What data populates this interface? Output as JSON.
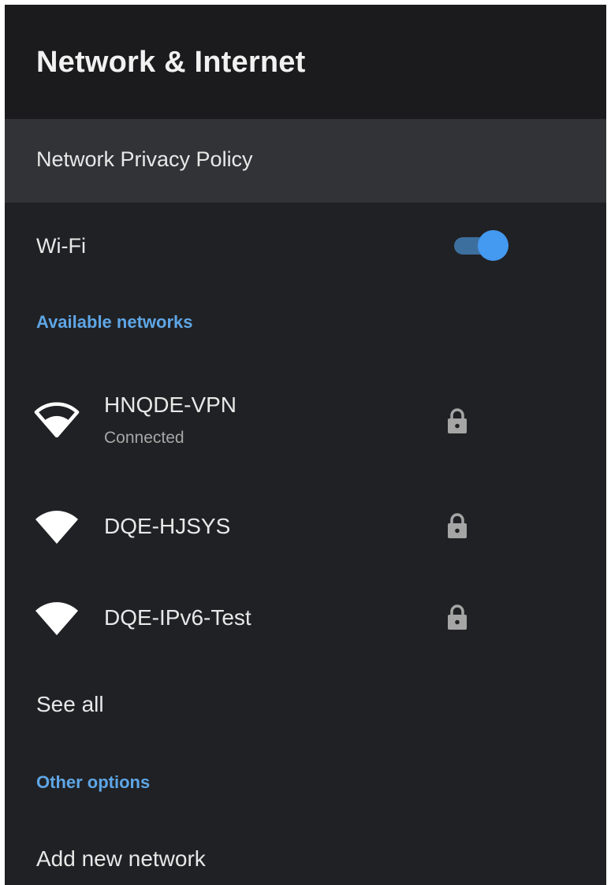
{
  "header": {
    "title": "Network & Internet"
  },
  "privacy": {
    "label": "Network Privacy Policy"
  },
  "wifi": {
    "label": "Wi-Fi",
    "enabled": true,
    "accent_color": "#4499f0"
  },
  "available": {
    "header": "Available networks",
    "networks": [
      {
        "name": "HNQDE-VPN",
        "status": "Connected",
        "secured": true,
        "icon": "wifi-signal-icon"
      },
      {
        "name": "DQE-HJSYS",
        "secured": true,
        "icon": "wifi-signal-icon"
      },
      {
        "name": "DQE-IPv6-Test",
        "secured": true,
        "icon": "wifi-signal-icon"
      }
    ],
    "see_all": "See all"
  },
  "other": {
    "header": "Other options",
    "add_network": "Add new network"
  },
  "colors": {
    "background": "#202124",
    "header_background": "#1b1b1d",
    "focused_row": "#323336",
    "section_header": "#5ea6e6",
    "primary_text": "#e8e8e8",
    "secondary_text": "#a7a7a7"
  }
}
